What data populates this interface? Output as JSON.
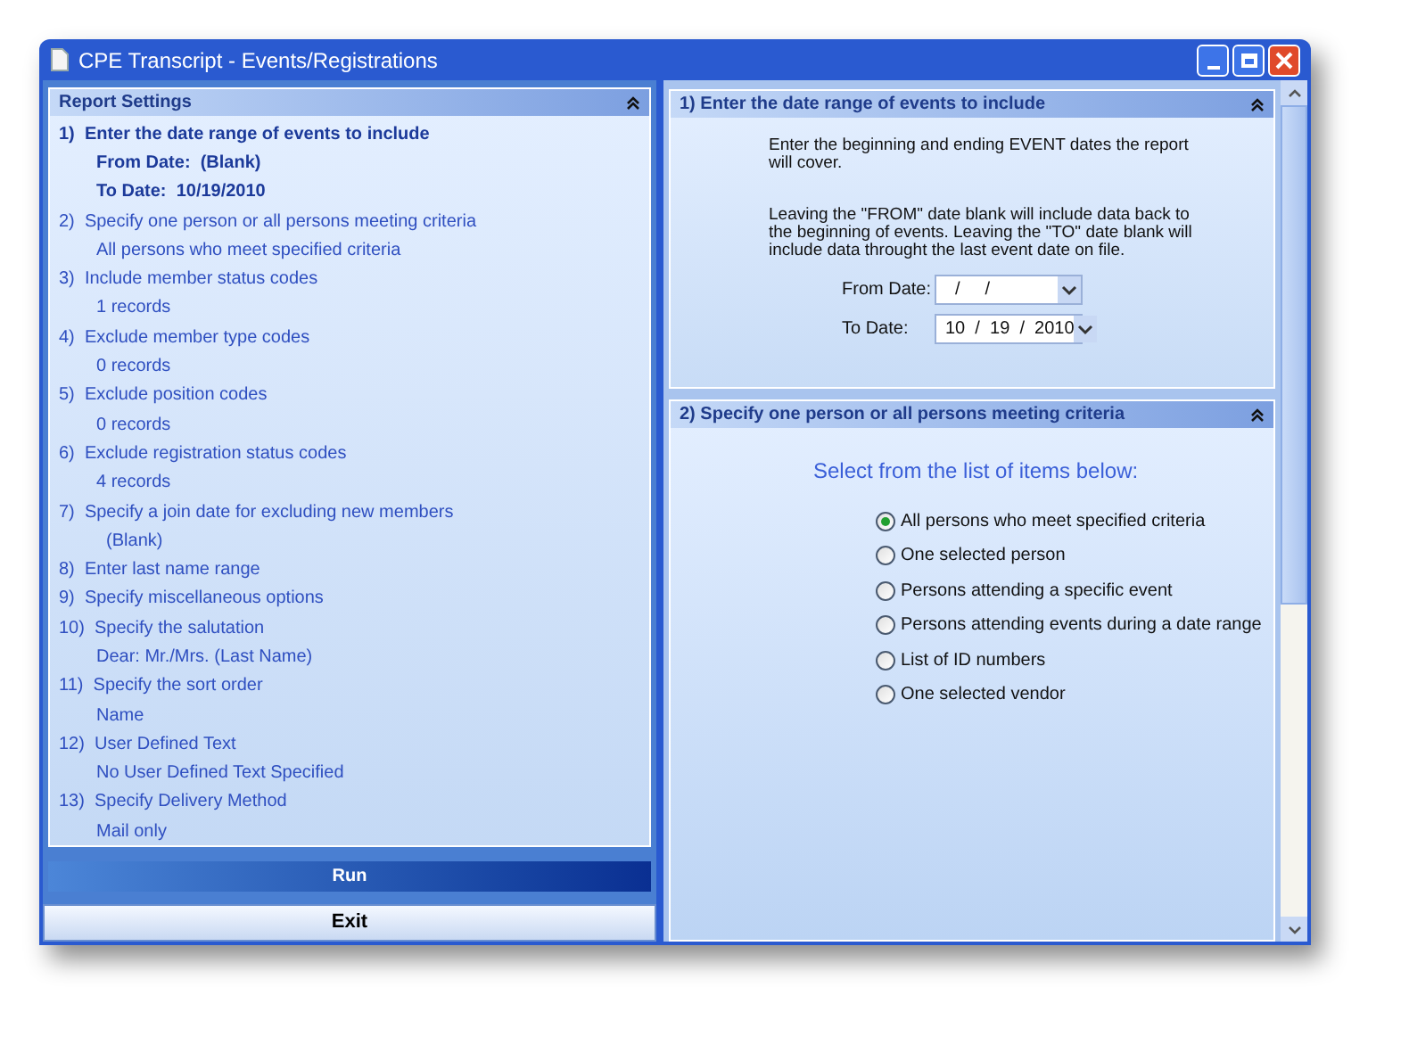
{
  "window": {
    "title": "CPE Transcript - Events/Registrations"
  },
  "report_settings": {
    "title": "Report Settings",
    "steps": [
      {
        "label": "1)  Enter the date range of events to include",
        "selected": true,
        "details": [
          "From Date:  (Blank)",
          "To Date:  10/19/2010"
        ]
      },
      {
        "label": "2)  Specify one person or all persons meeting criteria",
        "selected": false,
        "details": [
          "All persons who meet specified criteria"
        ]
      },
      {
        "label": "3)  Include member status codes",
        "selected": false,
        "details": [
          "1 records"
        ]
      },
      {
        "label": "4)  Exclude member type codes",
        "selected": false,
        "details": [
          "0 records"
        ]
      },
      {
        "label": "5)  Exclude position codes",
        "selected": false,
        "details": [
          "0 records"
        ]
      },
      {
        "label": "6)  Exclude registration status codes",
        "selected": false,
        "details": [
          "4 records"
        ]
      },
      {
        "label": "7)  Specify a join date for excluding new members",
        "selected": false,
        "details": [
          "  (Blank)"
        ]
      },
      {
        "label": "8)  Enter last name range",
        "selected": false
      },
      {
        "label": "9)  Specify miscellaneous options",
        "selected": false
      },
      {
        "label": "10)  Specify the salutation",
        "selected": false,
        "details": [
          "Dear: Mr./Mrs. (Last Name)"
        ]
      },
      {
        "label": "11)  Specify the sort order",
        "selected": false,
        "details": [
          "Name"
        ]
      },
      {
        "label": "12)  User Defined Text",
        "selected": false,
        "details": [
          "No User Defined Text Specified"
        ]
      },
      {
        "label": "13)  Specify Delivery Method",
        "selected": false,
        "details": [
          "Mail only"
        ]
      }
    ]
  },
  "buttons": {
    "run": "Run",
    "exit": "Exit"
  },
  "date_section": {
    "title": "1)  Enter the date range of events to include",
    "intro": "Enter the beginning and ending EVENT dates the report will cover.",
    "note": "Leaving the \"FROM\" date blank will include data back to the beginning of events.  Leaving the \"TO\" date blank will include data throught the last event date on file.",
    "fields": [
      {
        "label": "From Date:",
        "value": "  /     /"
      },
      {
        "label": "To Date:",
        "value": "10  /  19  /  2010"
      }
    ]
  },
  "person_section": {
    "title": "2)  Specify one person or all persons meeting criteria",
    "prompt": "Select from the list of items below:",
    "options": [
      {
        "label": "All persons who meet specified criteria",
        "selected": true
      },
      {
        "label": "One selected person",
        "selected": false
      },
      {
        "label": "Persons attending a specific event",
        "selected": false
      },
      {
        "label": "Persons attending events during a date range",
        "selected": false
      },
      {
        "label": "List of ID numbers",
        "selected": false
      },
      {
        "label": "One selected vendor",
        "selected": false
      }
    ]
  }
}
